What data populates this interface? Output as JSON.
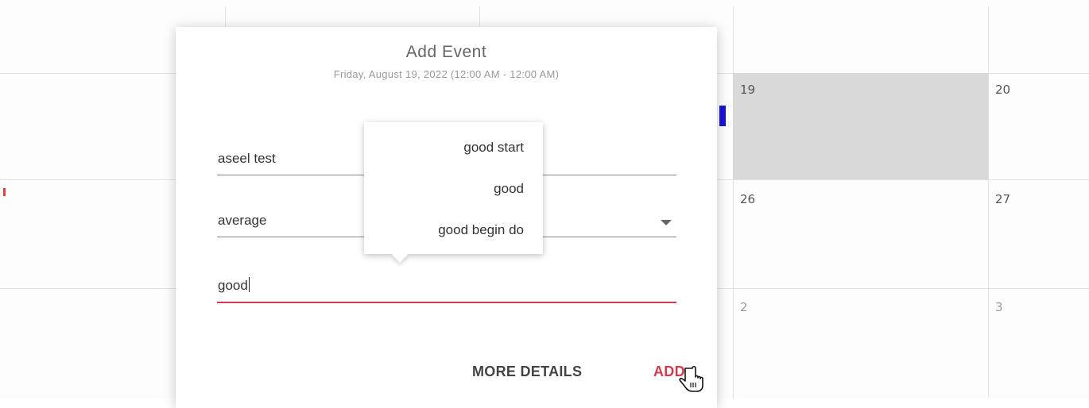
{
  "calendar": {
    "days": {
      "d19": "19",
      "d20": "20",
      "d26": "26",
      "d27": "27",
      "d2": "2",
      "d3": "3"
    },
    "highlight_color": "#d9d9d9",
    "event_color": "#1a13d6"
  },
  "dialog": {
    "title": "Add Event",
    "subtitle": "Friday, August 19, 2022 (12:00 AM - 12:00 AM)",
    "fields": {
      "name_value": "aseel test",
      "type_value": "average",
      "note_value": "good"
    },
    "autocomplete": {
      "options": [
        "good start",
        "good",
        "good begin do"
      ]
    },
    "buttons": {
      "more_details": "MORE DETAILS",
      "add": "ADD"
    },
    "accent_color": "#d23b4f"
  }
}
